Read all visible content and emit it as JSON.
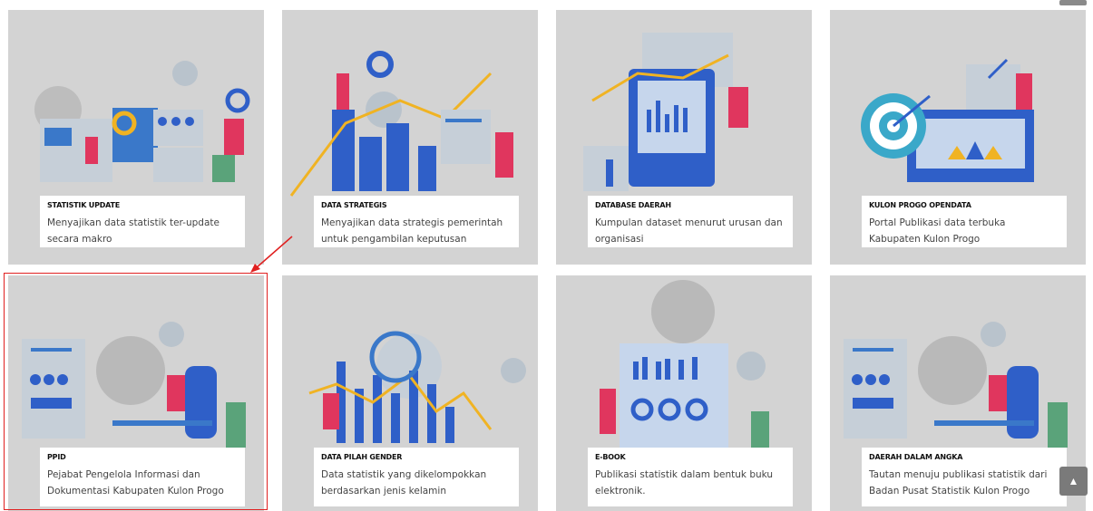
{
  "cards": [
    {
      "title": "STATISTIK UPDATE",
      "desc": "Menyajikan data statistik ter-update secara makro"
    },
    {
      "title": "DATA STRATEGIS",
      "desc": "Menyajikan data strategis pemerintah untuk pengambilan keputusan"
    },
    {
      "title": "DATABASE DAERAH",
      "desc": "Kumpulan dataset menurut urusan dan organisasi"
    },
    {
      "title": "KULON PROGO OPENDATA",
      "desc": "Portal Publikasi data terbuka Kabupaten Kulon Progo"
    },
    {
      "title": "PPID",
      "desc": "Pejabat Pengelola Informasi dan Dokumentasi Kabupaten Kulon Progo"
    },
    {
      "title": "DATA PILAH GENDER",
      "desc": "Data statistik yang dikelompokkan berdasarkan jenis kelamin"
    },
    {
      "title": "E-BOOK",
      "desc": "Publikasi statistik dalam bentuk buku elektronik."
    },
    {
      "title": "DAERAH DALAM ANGKA",
      "desc": "Tautan menuju publikasi statistik dari Badan Pusat Statistik Kulon Progo"
    }
  ],
  "scroll_top_icon": "chevron-up-icon",
  "colors": {
    "accent_blue": "#2f5fc8",
    "accent_pink": "#e0365e",
    "accent_yellow": "#f0b323",
    "highlight_red": "#e02020"
  }
}
